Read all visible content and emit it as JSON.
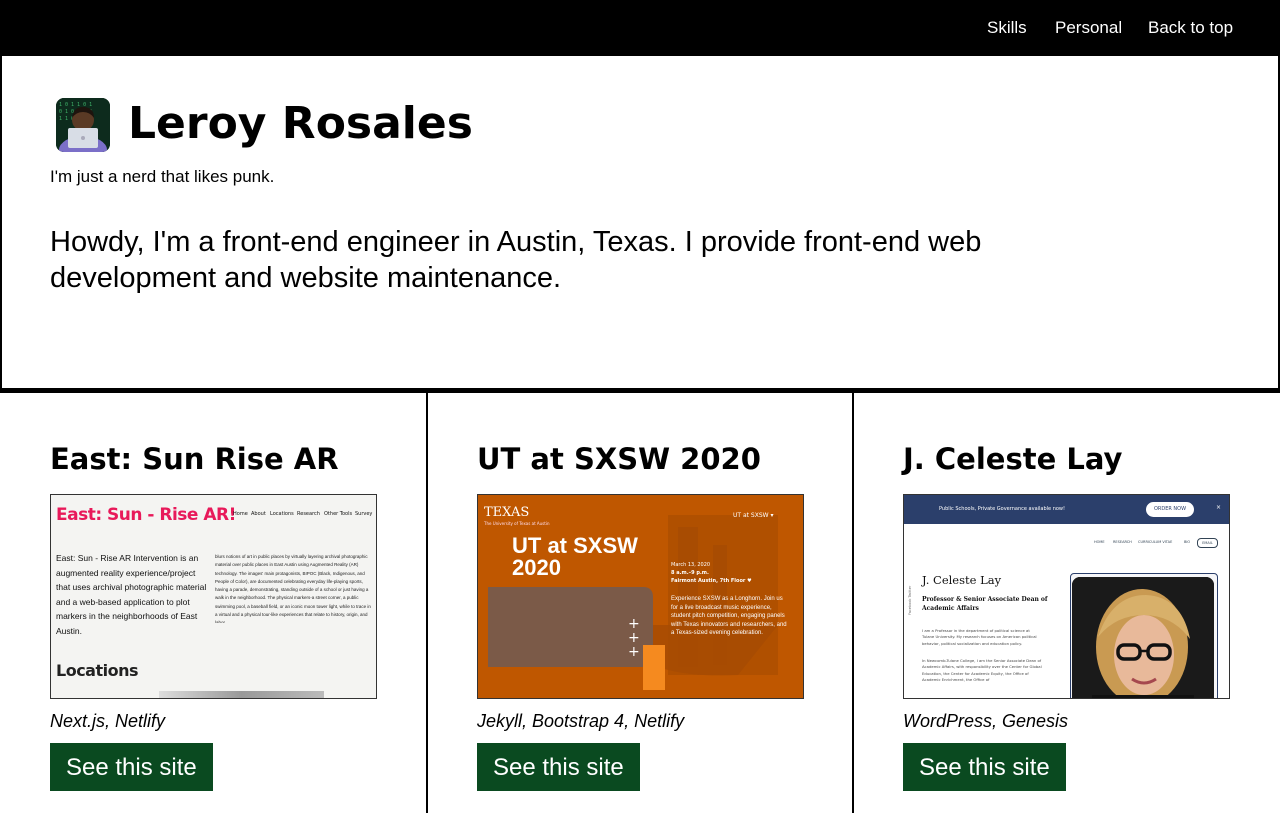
{
  "nav": {
    "items": [
      {
        "label": "Skills"
      },
      {
        "label": "Personal"
      },
      {
        "label": "Back to top"
      }
    ]
  },
  "header": {
    "name": "Leroy Rosales",
    "tagline": "I'm just a nerd that likes punk.",
    "avatar_icon": "developer-avatar-icon"
  },
  "intro": "Howdy, I'm a front-end engineer in Austin, Texas. I provide front-end web development and website maintenance.",
  "projects": [
    {
      "title": "East: Sun Rise AR",
      "stack": "Next.js, Netlify",
      "button": "See this site",
      "preview": {
        "brand": "East: Sun - Rise AR!",
        "nav": [
          "Home",
          "About",
          "Locations",
          "Research",
          "Other Tools",
          "Survey"
        ],
        "lead": "East: Sun - Rise AR Intervention is an augmented reality experience/project that uses archival photographic material and a web-based application to plot markers in the neighborhoods of East Austin.",
        "body_bold": "East: Sun - Rise AR Intervention",
        "body": "blurs notions of art in public places by virtually layering archival photographic material over public places in East Austin using Augmented Reality (AR) technology. The images' main protagonists, BIPOC (Black, Indigenous, and People of Color), are documented celebrating everyday life-playing sports, having a parade, demonstrating, standing outside of a school or just having a walk in the neighborhood. The physical markers-a street corner, a public swimming pool, a baseball field, or an iconic moon tower light, while to trace in a virtual and a physical tour-like experiences that relate to history, origin, and labor.",
        "section": "Locations"
      }
    },
    {
      "title": "UT at SXSW 2020",
      "stack": "Jekyll, Bootstrap 4, Netlify",
      "button": "See this site",
      "preview": {
        "logo": "TEXAS",
        "logo_sub": "The University of Texas at Austin",
        "menu": "UT at SXSW ▾",
        "headline": "UT at SXSW 2020",
        "date": "March 13, 2020",
        "time": "8 a.m.–9 p.m.",
        "venue": "Fairmont Austin, 7th Floor ♥",
        "desc": "Experience SXSW as a Longhorn. Join us for a live broadcast music experience, student pitch competition, engaging panels with Texas innovators and researchers, and a Texas-sized evening celebration."
      }
    },
    {
      "title": "J. Celeste Lay",
      "stack": "WordPress, Genesis",
      "button": "See this site",
      "preview": {
        "banner": "Public Schools, Private Governance available now!",
        "order": "ORDER NOW",
        "close": "×",
        "nav": [
          "HOME",
          "RESEARCH",
          "CURRICULUM VITAE",
          "BIO",
          "EMAIL"
        ],
        "name": "J. Celeste Lay",
        "role": "Professor & Senior Associate Dean of Academic Affairs",
        "p1": "I am a Professor in the department of political science at Tulane University. My research focuses on American political behavior, political socialization and education policy.",
        "p2": "In Newcomb-Tulane College, I am the Senior Associate Dean of Academic Affairs, with responsibility over the Center for Global Education, the Center for Academic Equity, the Office of Academic Enrichment, the Office of",
        "social": "Facebook Twitter"
      }
    }
  ],
  "colors": {
    "nav_bg": "#000000",
    "button_bg": "#0a4a20",
    "ut_orange": "#bf5700",
    "tulane_navy": "#2b3f6b",
    "east_pink": "#e8195a"
  }
}
